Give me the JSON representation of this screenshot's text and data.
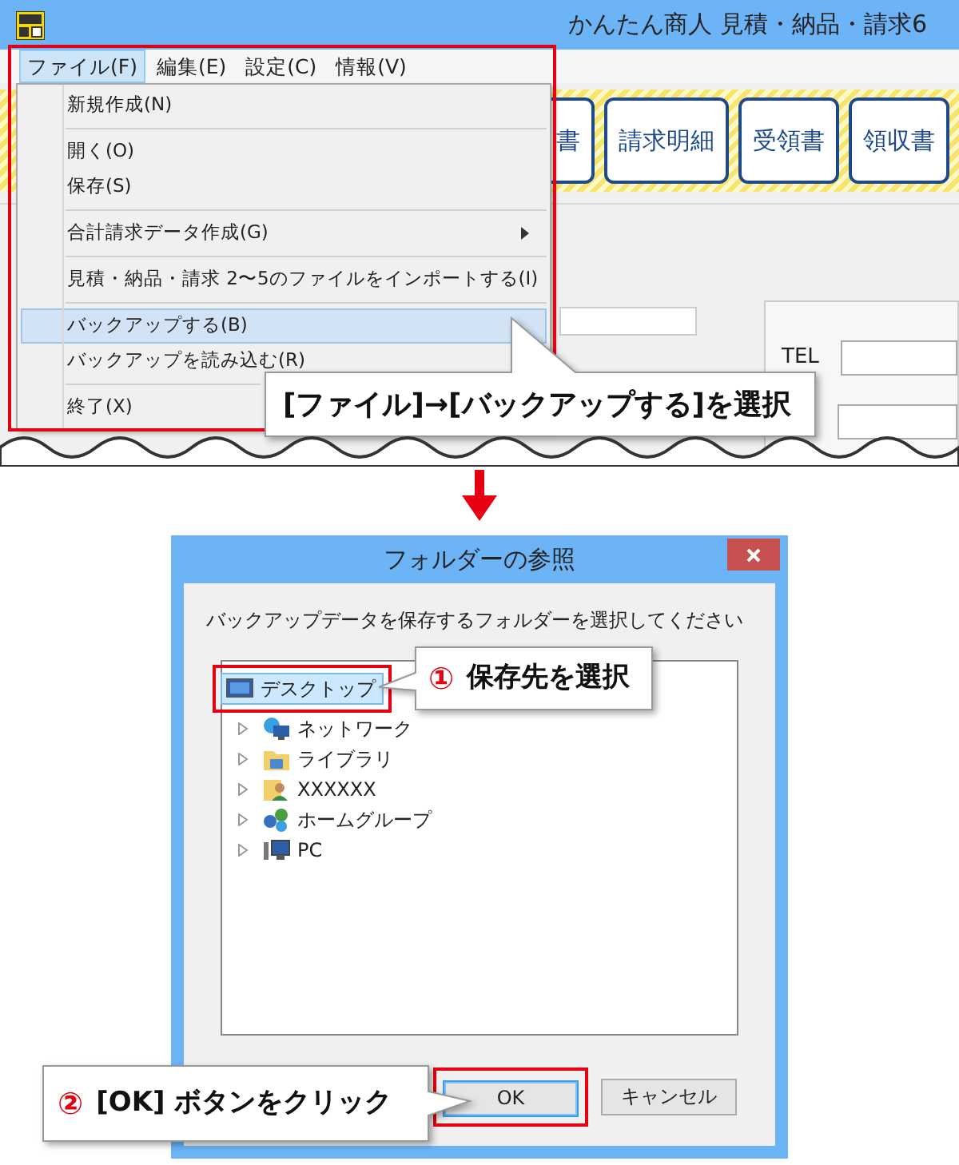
{
  "app": {
    "title": "かんたん商人 見積・納品・請求6",
    "menu_bar": [
      {
        "label": "ファイル(F)",
        "selected": true
      },
      {
        "label": "編集(E)",
        "selected": false
      },
      {
        "label": "設定(C)",
        "selected": false
      },
      {
        "label": "情報(V)",
        "selected": false
      }
    ],
    "toolbar_buttons": [
      "書",
      "請求明細",
      "受領書",
      "領収書"
    ],
    "tel_label": "TEL",
    "menu_items": [
      {
        "label": "新規作成(N)",
        "kind": "command",
        "selected": false,
        "separator_before": false
      },
      {
        "label": "開く(O)",
        "kind": "command",
        "selected": false,
        "separator_before": true
      },
      {
        "label": "保存(S)",
        "kind": "command",
        "selected": false,
        "separator_before": false
      },
      {
        "label": "合計請求データ作成(G)",
        "kind": "submenu",
        "selected": false,
        "separator_before": true
      },
      {
        "label": "見積・納品・請求 2〜5のファイルをインポートする(I)",
        "kind": "command",
        "selected": false,
        "separator_before": true
      },
      {
        "label": "バックアップする(B)",
        "kind": "command",
        "selected": true,
        "separator_before": true
      },
      {
        "label": "バックアップを読み込む(R)",
        "kind": "command",
        "selected": false,
        "separator_before": false
      },
      {
        "label": "終了(X)",
        "kind": "command",
        "selected": false,
        "separator_before": true
      }
    ]
  },
  "callouts": [
    {
      "text": "[ファイル]→[バックアップする]を選択"
    },
    {
      "number": "①",
      "text": "保存先を選択"
    },
    {
      "number": "②",
      "text": "[OK] ボタンをクリック"
    }
  ],
  "dialog": {
    "title": "フォルダーの参照",
    "instruction": "バックアップデータを保存するフォルダーを選択してください",
    "tree": [
      {
        "label": "デスクトップ",
        "kind": "desktop",
        "selected": true,
        "children": [
          {
            "label": "ネットワーク",
            "kind": "network",
            "selected": false
          },
          {
            "label": "ライブラリ",
            "kind": "library",
            "selected": false
          },
          {
            "label": "XXXXXX",
            "kind": "user",
            "selected": false
          },
          {
            "label": "ホームグループ",
            "kind": "homegroup",
            "selected": false
          },
          {
            "label": "PC",
            "kind": "pc",
            "selected": false
          }
        ]
      }
    ],
    "buttons": [
      {
        "label": "OK",
        "kind": "default"
      },
      {
        "label": "キャンセル",
        "kind": "normal"
      }
    ]
  }
}
